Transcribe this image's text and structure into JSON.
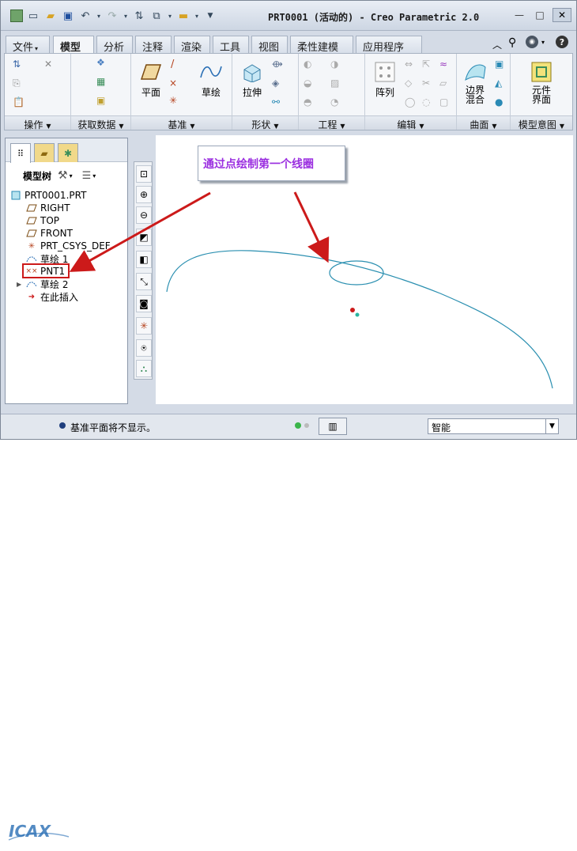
{
  "window": {
    "title": "PRT0001 (活动的) - Creo Parametric 2.0"
  },
  "ribbon_tabs": [
    {
      "label": "文件",
      "has_dropdown": true
    },
    {
      "label": "模型",
      "active": true
    },
    {
      "label": "分析"
    },
    {
      "label": "注释"
    },
    {
      "label": "渲染"
    },
    {
      "label": "工具"
    },
    {
      "label": "视图"
    },
    {
      "label": "柔性建模"
    },
    {
      "label": "应用程序"
    }
  ],
  "groups": {
    "operations": "操作",
    "get_data": "获取数据",
    "datum": "基准",
    "shapes": "形状",
    "engineering": "工程",
    "editing": "编辑",
    "surfaces": "曲面",
    "model_intent": "模型意图"
  },
  "buttons": {
    "plane": "平面",
    "sketch": "草绘",
    "extrude": "拉伸",
    "pattern": "阵列",
    "boundary_blend": "边界\n混合",
    "component_interface": "元件\n界面"
  },
  "model_tree": {
    "header": "模型树",
    "items": [
      {
        "label": "PRT0001.PRT",
        "icon": "part-icon"
      },
      {
        "label": "RIGHT",
        "icon": "datum-plane-icon"
      },
      {
        "label": "TOP",
        "icon": "datum-plane-icon"
      },
      {
        "label": "FRONT",
        "icon": "datum-plane-icon"
      },
      {
        "label": "PRT_CSYS_DEF",
        "icon": "csys-icon"
      },
      {
        "label": "草绘 1",
        "icon": "sketch-icon"
      },
      {
        "label": "PNT1",
        "icon": "datum-point-icon",
        "highlighted": true
      },
      {
        "label": "草绘 2",
        "icon": "sketch-icon",
        "expandable": true
      },
      {
        "label": "在此插入",
        "icon": "insert-arrow-icon"
      }
    ]
  },
  "callout": {
    "text": "通过点绘制第一个线圈"
  },
  "status": {
    "message": "基准平面将不显示。",
    "filter_value": "智能"
  },
  "colors": {
    "accent_red": "#cc1a1a",
    "curve": "#2a8fb0",
    "callout_text": "#9b2fe0"
  }
}
